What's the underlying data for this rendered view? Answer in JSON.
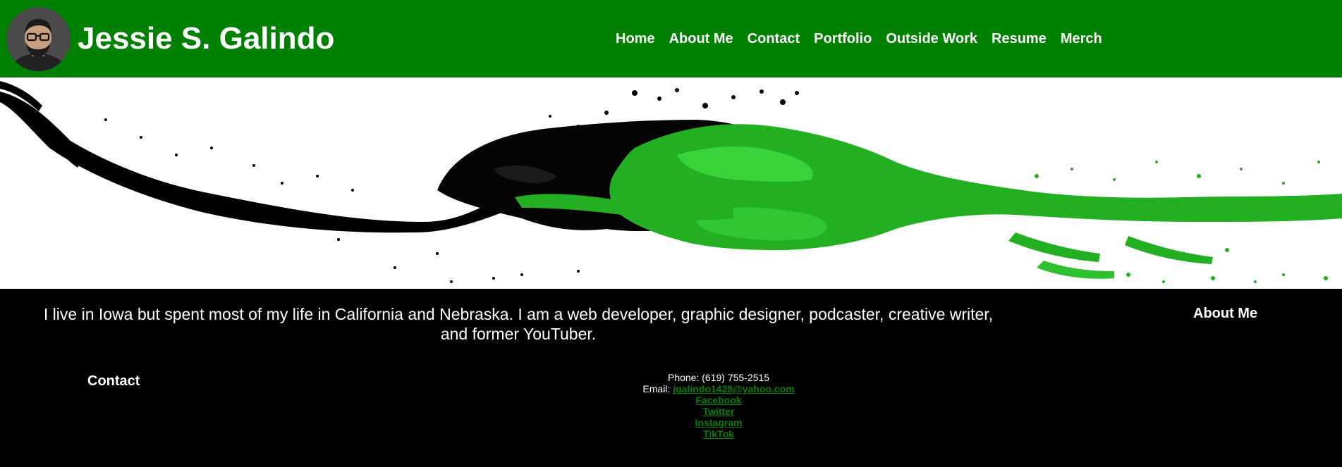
{
  "header": {
    "site_title": "Jessie S. Galindo",
    "nav": [
      "Home",
      "About Me",
      "Contact",
      "Portfolio",
      "Outside Work",
      "Resume",
      "Merch"
    ],
    "background_color": "#008000"
  },
  "banner": {
    "description_icon": "paint-splash-icon",
    "colors": [
      "#000000",
      "#1fbf1f",
      "#ffffff"
    ]
  },
  "about": {
    "intro": "I live in Iowa but spent most of my life in California and Nebraska. I am a web developer, graphic designer, podcaster, creative writer, and former YouTuber.",
    "heading": "About Me"
  },
  "contact": {
    "heading": "Contact",
    "phone_label": "Phone:",
    "phone": "(619) 755-2515",
    "email_label": "Email:",
    "email": "jgalindo1428@yahoo.com",
    "links": [
      "Facebook",
      "Twitter",
      "Instagram",
      "TikTok"
    ],
    "link_color": "#008000"
  }
}
